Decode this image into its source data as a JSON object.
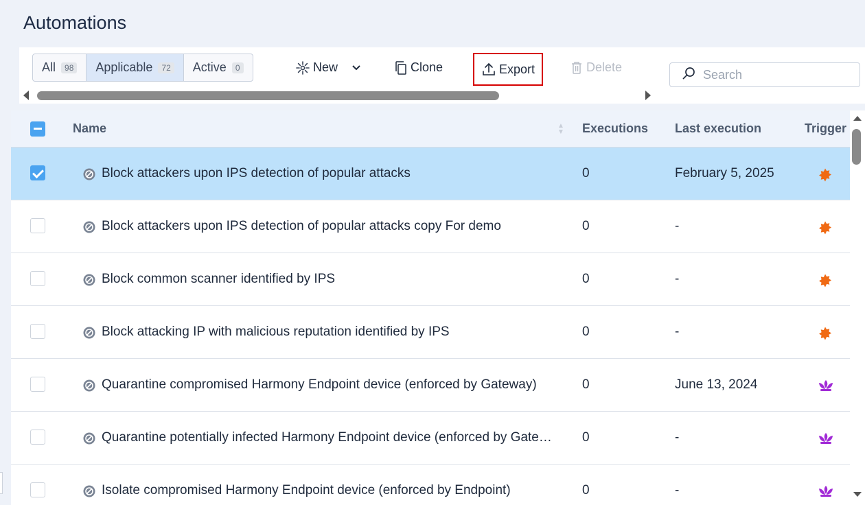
{
  "page": {
    "title": "Automations"
  },
  "filters": [
    {
      "label": "All",
      "count": "98"
    },
    {
      "label": "Applicable",
      "count": "72"
    },
    {
      "label": "Active",
      "count": "0"
    }
  ],
  "toolbar": {
    "new_label": "New",
    "clone_label": "Clone",
    "export_label": "Export",
    "delete_label": "Delete"
  },
  "search": {
    "placeholder": "Search",
    "value": ""
  },
  "table": {
    "columns": {
      "name": "Name",
      "executions": "Executions",
      "last_execution": "Last execution",
      "trigger": "Trigger"
    },
    "rows": [
      {
        "name": "Block attackers upon IPS detection of popular attacks",
        "executions": "0",
        "last": "February 5, 2025",
        "trigger_icon": "ips-trigger-icon",
        "selected": true
      },
      {
        "name": "Block attackers upon IPS detection of popular attacks copy For demo",
        "executions": "0",
        "last": "-",
        "trigger_icon": "ips-trigger-icon",
        "selected": false
      },
      {
        "name": "Block common scanner identified by IPS",
        "executions": "0",
        "last": "-",
        "trigger_icon": "ips-trigger-icon",
        "selected": false
      },
      {
        "name": "Block attacking IP with malicious reputation identified by IPS",
        "executions": "0",
        "last": "-",
        "trigger_icon": "ips-trigger-icon",
        "selected": false
      },
      {
        "name": "Quarantine compromised Harmony Endpoint device (enforced by Gateway)",
        "executions": "0",
        "last": "June 13, 2024",
        "trigger_icon": "endpoint-trigger-icon",
        "selected": false
      },
      {
        "name": "Quarantine potentially infected Harmony Endpoint device (enforced by Gateway)",
        "executions": "0",
        "last": "-",
        "trigger_icon": "endpoint-trigger-icon",
        "selected": false
      },
      {
        "name": "Isolate compromised Harmony Endpoint device (enforced by Endpoint)",
        "executions": "0",
        "last": "-",
        "trigger_icon": "endpoint-trigger-icon",
        "selected": false
      }
    ]
  },
  "colors": {
    "ips_trigger": "#f06a14",
    "endpoint_trigger": "#a12ad6",
    "selected_row": "#bde1fb",
    "accent": "#4aa3f0",
    "highlight_border": "#d60000"
  }
}
